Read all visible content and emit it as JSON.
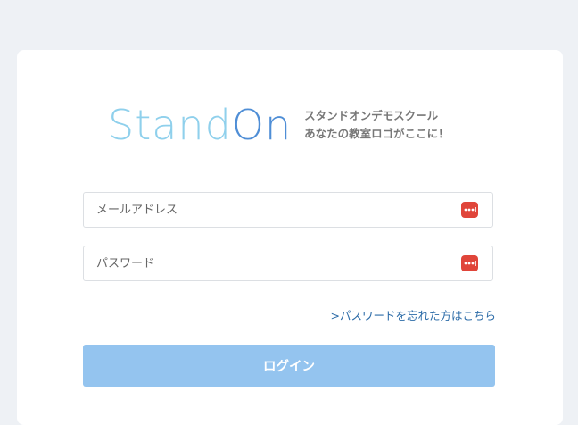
{
  "logo": {
    "part1": "Stand",
    "part2": "On",
    "tagline_line1": "スタンドオンデモスクール",
    "tagline_line2": "あなたの教室ロゴがここに！"
  },
  "form": {
    "email_placeholder": "メールアドレス",
    "password_placeholder": "パスワード",
    "forgot_link": ">パスワードを忘れた方はこちら",
    "login_label": "ログイン"
  },
  "icons": {
    "field_icon": "password-manager-icon"
  },
  "colors": {
    "background": "#eef1f5",
    "logo_light_blue": "#8fd0ec",
    "logo_blue": "#4f8ed6",
    "link": "#2d6ca8",
    "button": "#94c4ef",
    "field_icon": "#e0453a"
  }
}
